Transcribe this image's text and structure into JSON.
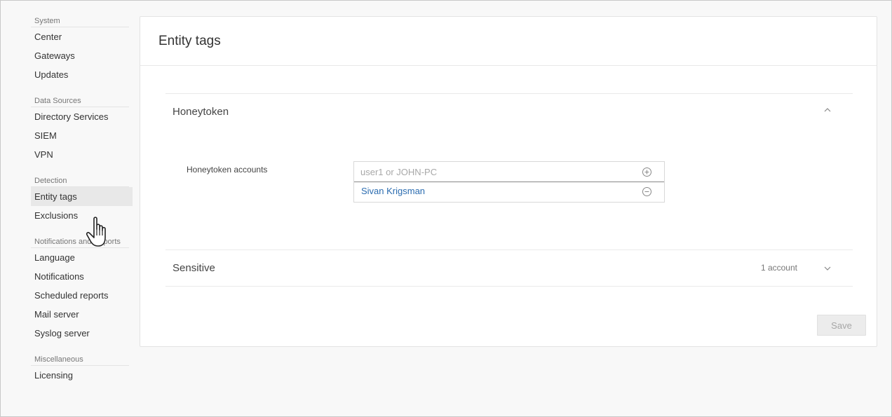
{
  "sidebar": {
    "groups": [
      {
        "title": "System",
        "items": [
          {
            "label": "Center"
          },
          {
            "label": "Gateways"
          },
          {
            "label": "Updates"
          }
        ]
      },
      {
        "title": "Data Sources",
        "items": [
          {
            "label": "Directory Services"
          },
          {
            "label": "SIEM"
          },
          {
            "label": "VPN"
          }
        ]
      },
      {
        "title": "Detection",
        "items": [
          {
            "label": "Entity tags",
            "active": true
          },
          {
            "label": "Exclusions"
          }
        ]
      },
      {
        "title": "Notifications and Reports",
        "items": [
          {
            "label": "Language"
          },
          {
            "label": "Notifications"
          },
          {
            "label": "Scheduled reports"
          },
          {
            "label": "Mail server"
          },
          {
            "label": "Syslog server"
          }
        ]
      },
      {
        "title": "Miscellaneous",
        "items": [
          {
            "label": "Licensing"
          }
        ]
      }
    ]
  },
  "main": {
    "title": "Entity tags",
    "honeytoken": {
      "title": "Honeytoken",
      "expanded": true,
      "field_label": "Honeytoken accounts",
      "input_placeholder": "user1 or JOHN-PC",
      "input_value": "",
      "accounts": [
        "Sivan Krigsman"
      ]
    },
    "sensitive": {
      "title": "Sensitive",
      "count_label": "1 account",
      "expanded": false
    },
    "save_label": "Save"
  },
  "colors": {
    "link": "#2b6cb0",
    "active_nav_bg": "#e8e8e8",
    "disabled_button_bg": "#ececec"
  },
  "icons": {
    "add": "plus-circle-icon",
    "remove": "minus-circle-icon",
    "collapse": "chevron-up-icon",
    "expand": "chevron-down-icon",
    "cursor": "hand-pointer-cursor-icon"
  }
}
